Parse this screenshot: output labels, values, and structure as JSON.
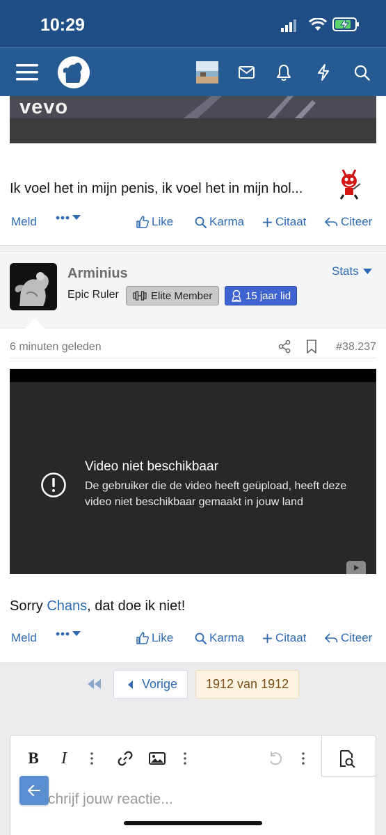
{
  "status_bar": {
    "time": "10:29"
  },
  "top_video": {
    "watermark": "vevo"
  },
  "post1": {
    "text": "Ik voel het in mijn penis, ik voel het in mijn hol..."
  },
  "actions": {
    "report": "Meld",
    "like": "Like",
    "karma": "Karma",
    "quote": "Citaat",
    "reply": "Citeer"
  },
  "post2": {
    "author": "Arminius",
    "user_title": "Epic Ruler",
    "badge_elite": "Elite Member",
    "badge_years": "15 jaar lid",
    "stats_label": "Stats",
    "timestamp": "6 minuten geleden",
    "post_number": "#38.237",
    "video_error_title": "Video niet beschikbaar",
    "video_error_message": "De gebruiker die de video heeft geüpload, heeft deze video niet beschikbaar gemaakt in jouw land",
    "text_before": "Sorry ",
    "mention": "Chans",
    "text_after": ", dat doe ik niet!"
  },
  "pagination": {
    "prev_label": "Vorige",
    "current": "1912 van 1912"
  },
  "editor": {
    "placeholder": "Schrijf jouw reactie...",
    "bold": "B",
    "italic": "I"
  },
  "colors": {
    "navbar": "#265a92",
    "statusbar": "#1f4e86",
    "link": "#2d6ab3",
    "badge_years": "#3f63cf",
    "badge_elite": "#c9c9c9",
    "pager_current_bg": "#fdf3e3"
  }
}
